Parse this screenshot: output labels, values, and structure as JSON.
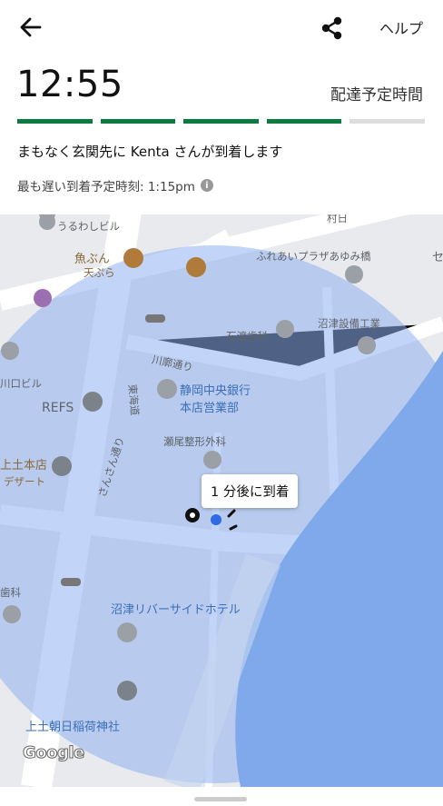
{
  "header": {
    "help_label": "ヘルプ",
    "back_icon": "back-arrow-icon",
    "share_icon": "share-icon"
  },
  "delivery": {
    "eta_time": "12:55",
    "eta_label": "配達予定時間",
    "progress_completed_segments": 4,
    "progress_total_segments": 5,
    "status_message": "まもなく玄関先に Kenta さんが到着します",
    "latest_arrival_text": "最も遅い到着予定時刻: 1:15pm"
  },
  "map": {
    "tooltip": "1 分後に到着",
    "attribution": "Google",
    "labels": {
      "uruwashi": "うるわしビル",
      "uobun": "魚ぶん",
      "tempura": "天ぷら",
      "fureai": "ふれあいプラザあゆみ橋",
      "ishiwatari": "石渡歯科",
      "numazu_setsubi": "沼津設備工業",
      "kawarosdori": "川廓通り",
      "shizuoka_bank1": "静岡中央銀行",
      "shizuoka_bank2": "本店営業部",
      "kawaguchi": "川口ビル",
      "refs": "REFS",
      "kaizumi": "東海道",
      "seo": "瀬尾整形外科",
      "kamitsuchi1": "上土本店",
      "kamitsuchi2": "デザート",
      "sansan": "さんさん通り",
      "dental": "歯科",
      "riverside_hotel": "沼津リバーサイドホテル",
      "inari": "上土朝日稲荷神社",
      "right_edge": "セ",
      "top_edge": "村日"
    }
  },
  "colors": {
    "accent": "#0d7a40",
    "radius_fill": "#8fb1f0",
    "river": "#7fa9ea"
  }
}
